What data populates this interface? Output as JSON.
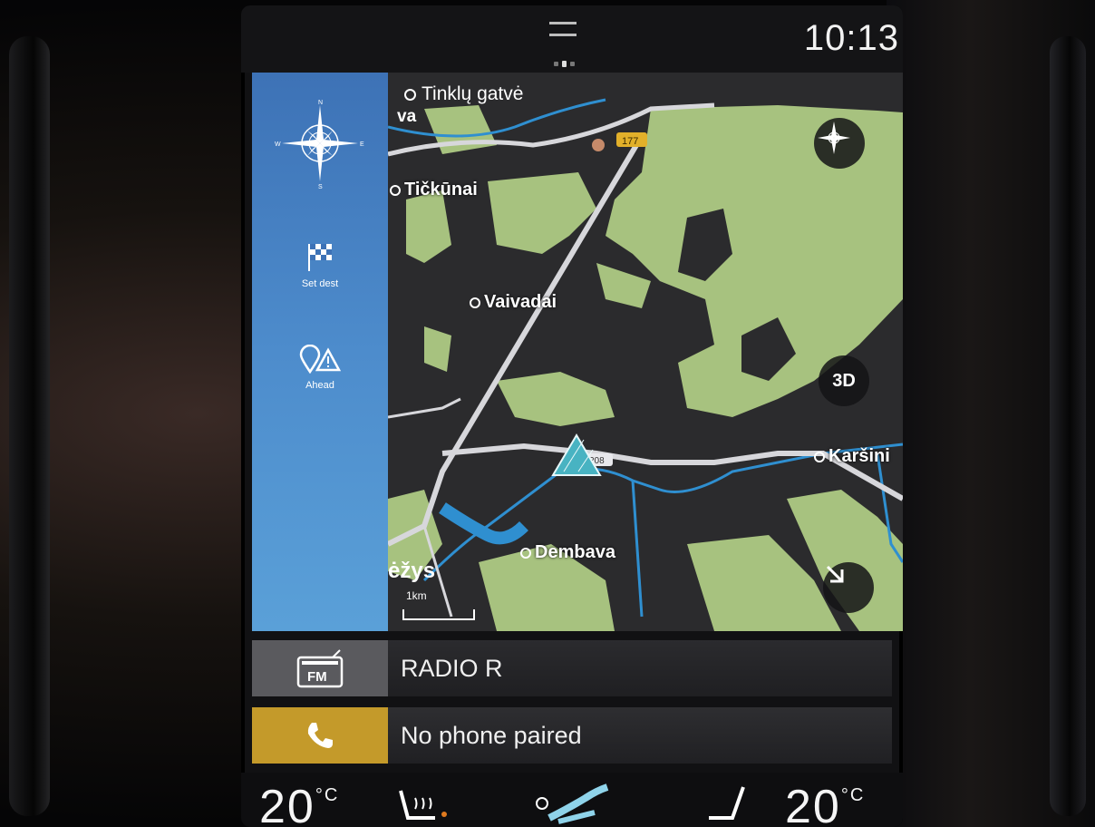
{
  "status_bar": {
    "time": "10:13"
  },
  "nav_panel": {
    "compass_icon": "compass-rose-icon",
    "items": [
      {
        "label": "Set dest",
        "icon": "checkered-flag-icon"
      },
      {
        "label": "Ahead",
        "icon": "pin-warning-icon"
      }
    ]
  },
  "map": {
    "street_label": "Tinklų gatvė",
    "partial_label_top": "va",
    "road_badge_top": "177",
    "road_badge_mid": "208",
    "places": [
      {
        "name": "Tičkūnai"
      },
      {
        "name": "Vaivadai"
      },
      {
        "name": "Dembava"
      },
      {
        "name": "Karšini"
      }
    ],
    "partial_label_bottom": "ėžys",
    "scale": "1km",
    "button_3d": "3D",
    "colors": {
      "forest": "#a7c27f",
      "ground": "#2b2b2d",
      "water": "#2f8fd0",
      "road": "#d7d7db",
      "vehicle": "#48b3c2"
    }
  },
  "media": {
    "radio": {
      "badge": "FM",
      "label": "RADIO R"
    },
    "phone": {
      "label": "No phone paired"
    }
  },
  "climate": {
    "left_temp": "20",
    "right_temp": "20",
    "unit": "°C"
  }
}
